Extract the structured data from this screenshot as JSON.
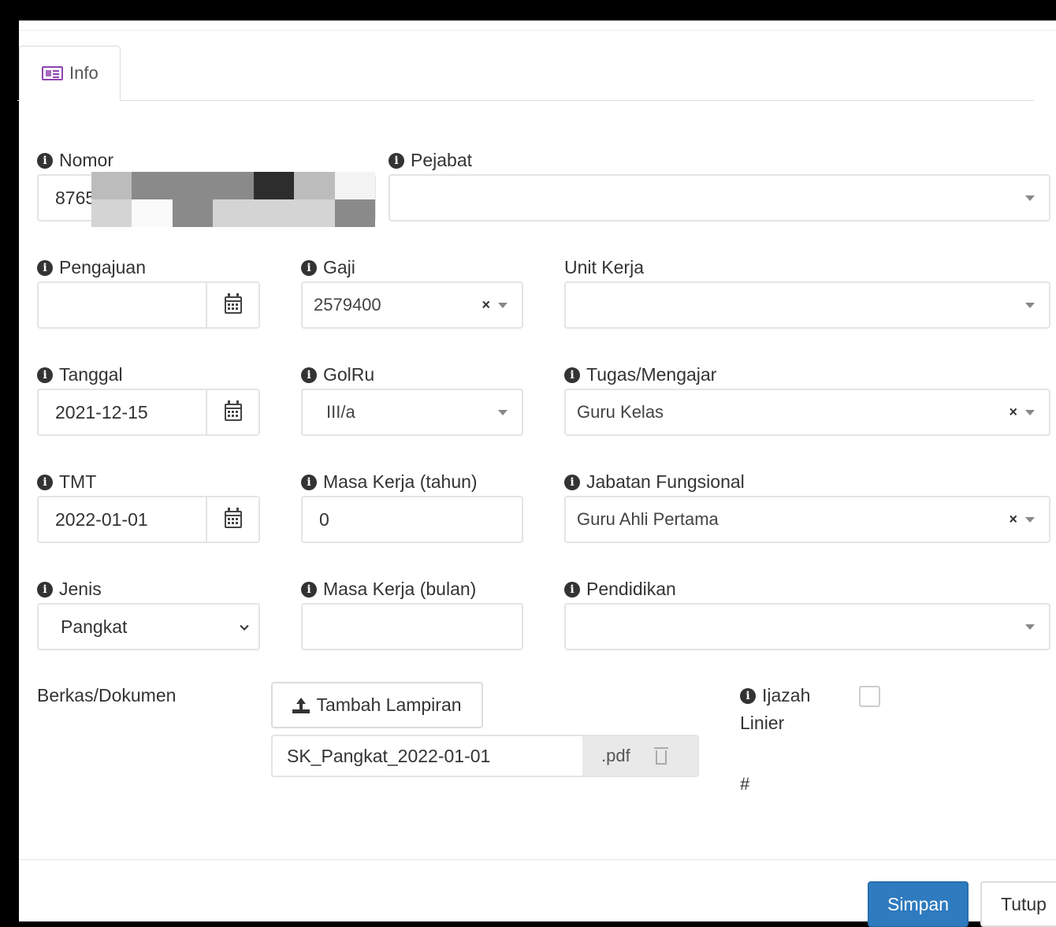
{
  "tabs": [
    {
      "label": "Info",
      "icon": "id-card-icon"
    }
  ],
  "form": {
    "nomor": {
      "label": "Nomor",
      "value": "8765"
    },
    "pejabat": {
      "label": "Pejabat",
      "value": ""
    },
    "pengajuan": {
      "label": "Pengajuan",
      "value": ""
    },
    "gaji": {
      "label": "Gaji",
      "value": "2579400"
    },
    "unit_kerja": {
      "label": "Unit Kerja",
      "value": ""
    },
    "tanggal": {
      "label": "Tanggal",
      "value": "2021-12-15"
    },
    "golru": {
      "label": "GolRu",
      "value": "III/a"
    },
    "tugas": {
      "label": "Tugas/Mengajar",
      "value": "Guru Kelas"
    },
    "tmt": {
      "label": "TMT",
      "value": "2022-01-01"
    },
    "masa_kerja_tahun": {
      "label": "Masa Kerja (tahun)",
      "value": "0"
    },
    "jabatan": {
      "label": "Jabatan Fungsional",
      "value": "Guru Ahli Pertama"
    },
    "jenis": {
      "label": "Jenis",
      "value": "Pangkat"
    },
    "masa_kerja_bulan": {
      "label": "Masa Kerja (bulan)",
      "value": ""
    },
    "pendidikan": {
      "label": "Pendidikan",
      "value": ""
    },
    "berkas": {
      "label": "Berkas/Dokumen",
      "add_button": "Tambah Lampiran",
      "file_name": "SK_Pangkat_2022-01-01",
      "file_ext": ".pdf"
    },
    "ijazah": {
      "label_line1": "Ijazah",
      "label_line2": "Linier",
      "checked": false
    },
    "hash": "#"
  },
  "footer": {
    "save_label": "Simpan",
    "close_label": "Tutup",
    "save_color": "#2e7bbf"
  }
}
